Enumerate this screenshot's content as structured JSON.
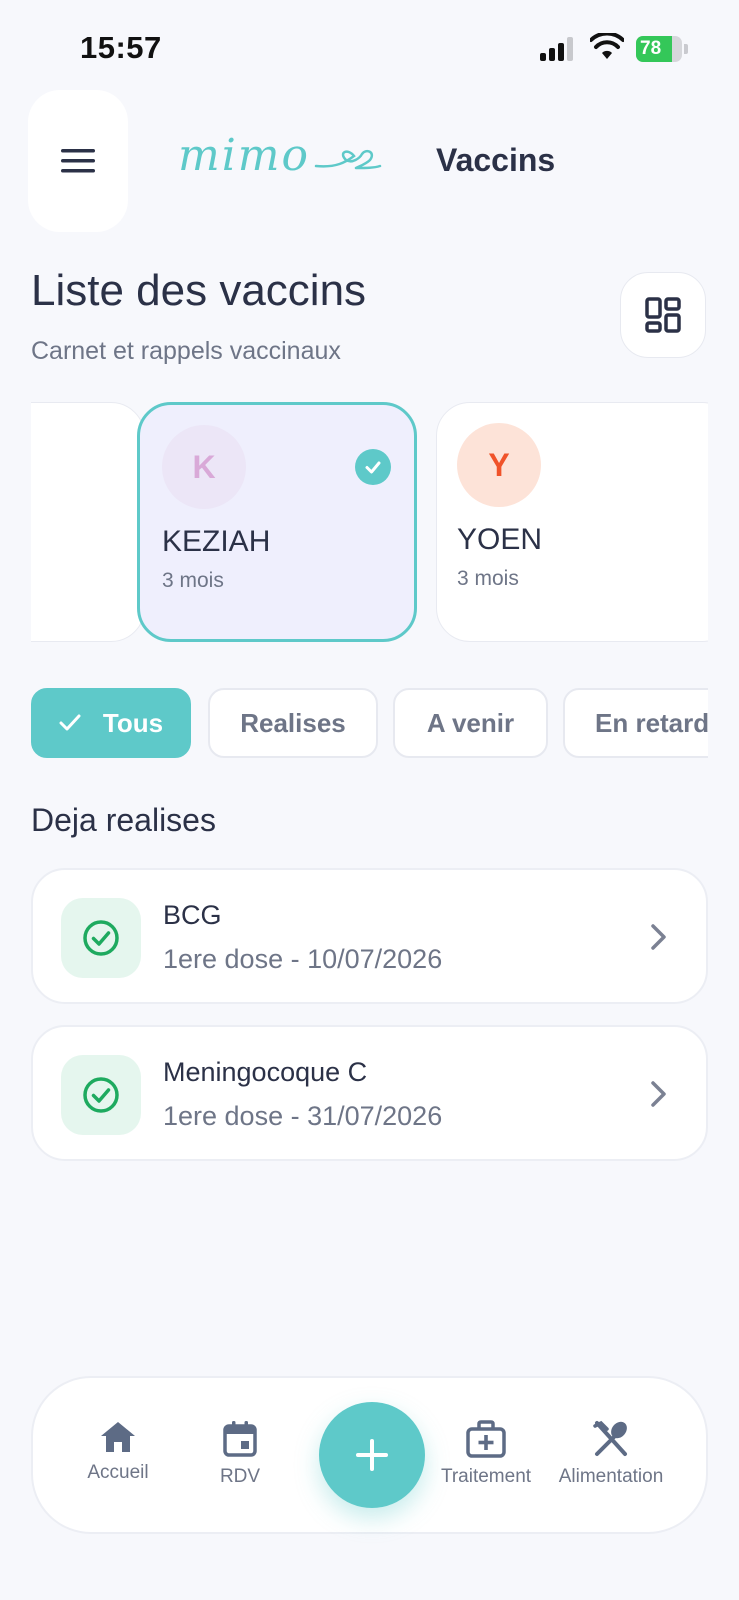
{
  "status_bar": {
    "time": "15:57",
    "battery": "78"
  },
  "header": {
    "logo_text": "mimo",
    "title": "Vaccins"
  },
  "page": {
    "title": "Liste des vaccins",
    "subtitle": "Carnet et rappels vaccinaux"
  },
  "profiles": [
    {
      "initial": "",
      "name": "",
      "age": "",
      "selected": false
    },
    {
      "initial": "K",
      "name": "KEZIAH",
      "age": "3 mois",
      "selected": true,
      "avatar_bg": "#ece6f7",
      "avatar_color": "#d9a9d8"
    },
    {
      "initial": "Y",
      "name": "YOEN",
      "age": "3 mois",
      "selected": false,
      "avatar_bg": "#fde3d8",
      "avatar_color": "#f0532a"
    }
  ],
  "filters": [
    {
      "label": "Tous",
      "active": true
    },
    {
      "label": "Realises",
      "active": false
    },
    {
      "label": "A venir",
      "active": false
    },
    {
      "label": "En retard",
      "active": false
    }
  ],
  "section": {
    "title": "Deja realises"
  },
  "vaccines": [
    {
      "name": "BCG",
      "dose": "1ere dose - 10/07/2026",
      "status_icon": "check-circle-icon"
    },
    {
      "name": "Meningocoque C",
      "dose": "1ere dose - 31/07/2026",
      "status_icon": "check-circle-icon"
    }
  ],
  "nav": [
    {
      "label": "Accueil",
      "icon": "home-icon"
    },
    {
      "label": "RDV",
      "icon": "calendar-icon"
    },
    {
      "label": "",
      "icon": "plus-icon"
    },
    {
      "label": "Traitement",
      "icon": "medical-kit-icon"
    },
    {
      "label": "Alimentation",
      "icon": "utensils-icon"
    }
  ],
  "colors": {
    "accent": "#5ec9c9",
    "success": "#1eaa5f",
    "text": "#2b3147",
    "muted": "#6e7587",
    "background": "#f7f8fc"
  }
}
